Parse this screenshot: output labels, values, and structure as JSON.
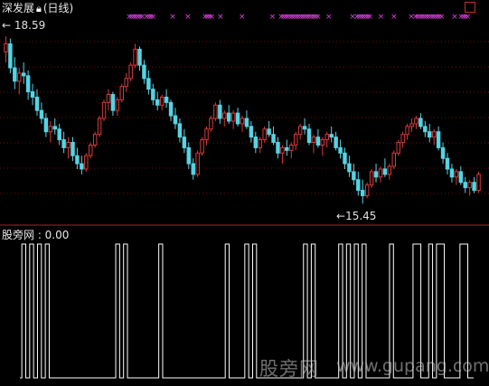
{
  "header": {
    "title": "深发展",
    "lock_icon": "lock-icon",
    "period": "(日线)"
  },
  "price_panel": {
    "high_label": "18.59",
    "low_label": "15.45",
    "arrow": "←",
    "up_color": "#d83a3a",
    "down_color": "#54d4e4",
    "signal_color": "#e040e0"
  },
  "indicator_panel": {
    "label": "股旁网 : 0.00",
    "line_color": "#ffffff"
  },
  "watermark": {
    "text": "股旁网",
    "url": "www.gupang.com"
  },
  "chart_data": {
    "type": "candlestick",
    "high": 18.59,
    "low": 15.45,
    "ylim": [
      15.2,
      18.9
    ],
    "signals_top": [
      20,
      21,
      22,
      23,
      24,
      25,
      26,
      28,
      29,
      30,
      31,
      40,
      47,
      55,
      56,
      57,
      58,
      62,
      72,
      86,
      90,
      91,
      92,
      93,
      94,
      95,
      96,
      97,
      98,
      99,
      100,
      101,
      102,
      103,
      104,
      105,
      106,
      107,
      112,
      123,
      125,
      126,
      127,
      128,
      129,
      130,
      131,
      136,
      142,
      150,
      152,
      153,
      154,
      155,
      156,
      157,
      158,
      159,
      160,
      161,
      162,
      163,
      164,
      170,
      173,
      174,
      175,
      176
    ],
    "candles": [
      [
        18.3,
        18.59,
        18.1,
        18.45
      ],
      [
        18.45,
        18.55,
        17.9,
        18.0
      ],
      [
        18.0,
        18.2,
        17.6,
        17.75
      ],
      [
        17.75,
        18.0,
        17.5,
        17.9
      ],
      [
        17.9,
        18.1,
        17.7,
        17.85
      ],
      [
        17.85,
        17.95,
        17.4,
        17.55
      ],
      [
        17.55,
        17.7,
        17.3,
        17.45
      ],
      [
        17.45,
        17.6,
        17.1,
        17.2
      ],
      [
        17.2,
        17.35,
        16.95,
        17.05
      ],
      [
        17.05,
        17.15,
        16.7,
        16.8
      ],
      [
        16.8,
        17.0,
        16.6,
        16.9
      ],
      [
        16.9,
        17.05,
        16.75,
        16.85
      ],
      [
        16.85,
        16.95,
        16.55,
        16.65
      ],
      [
        16.65,
        16.8,
        16.4,
        16.5
      ],
      [
        16.5,
        16.7,
        16.3,
        16.6
      ],
      [
        16.6,
        16.7,
        16.25,
        16.35
      ],
      [
        16.35,
        16.5,
        16.1,
        16.2
      ],
      [
        16.2,
        16.35,
        16.0,
        16.1
      ],
      [
        16.1,
        16.4,
        16.05,
        16.35
      ],
      [
        16.35,
        16.6,
        16.3,
        16.55
      ],
      [
        16.55,
        16.8,
        16.5,
        16.75
      ],
      [
        16.75,
        17.1,
        16.7,
        17.05
      ],
      [
        17.05,
        17.4,
        17.0,
        17.35
      ],
      [
        17.35,
        17.6,
        17.2,
        17.5
      ],
      [
        17.5,
        17.55,
        17.1,
        17.2
      ],
      [
        17.2,
        17.45,
        17.1,
        17.4
      ],
      [
        17.4,
        17.7,
        17.35,
        17.65
      ],
      [
        17.65,
        17.9,
        17.55,
        17.8
      ],
      [
        17.8,
        18.1,
        17.75,
        18.05
      ],
      [
        18.05,
        18.45,
        18.0,
        18.35
      ],
      [
        18.35,
        18.4,
        17.95,
        18.05
      ],
      [
        18.05,
        18.15,
        17.7,
        17.8
      ],
      [
        17.8,
        17.95,
        17.5,
        17.6
      ],
      [
        17.6,
        17.7,
        17.3,
        17.4
      ],
      [
        17.4,
        17.55,
        17.2,
        17.3
      ],
      [
        17.3,
        17.5,
        17.2,
        17.45
      ],
      [
        17.45,
        17.6,
        17.25,
        17.35
      ],
      [
        17.35,
        17.4,
        17.0,
        17.1
      ],
      [
        17.1,
        17.25,
        16.85,
        16.95
      ],
      [
        16.95,
        17.05,
        16.6,
        16.7
      ],
      [
        16.7,
        16.85,
        16.4,
        16.5
      ],
      [
        16.5,
        16.6,
        16.1,
        16.2
      ],
      [
        16.2,
        16.3,
        15.9,
        16.0
      ],
      [
        16.0,
        16.45,
        15.95,
        16.4
      ],
      [
        16.4,
        16.7,
        16.35,
        16.65
      ],
      [
        16.65,
        16.9,
        16.55,
        16.85
      ],
      [
        16.85,
        17.1,
        16.8,
        17.05
      ],
      [
        17.05,
        17.35,
        17.0,
        17.3
      ],
      [
        17.3,
        17.4,
        16.95,
        17.05
      ],
      [
        17.05,
        17.2,
        16.9,
        17.15
      ],
      [
        17.15,
        17.3,
        16.95,
        17.0
      ],
      [
        17.0,
        17.2,
        16.85,
        17.15
      ],
      [
        17.15,
        17.25,
        16.9,
        16.95
      ],
      [
        16.95,
        17.1,
        16.8,
        17.05
      ],
      [
        17.05,
        17.2,
        16.85,
        16.9
      ],
      [
        16.9,
        17.0,
        16.6,
        16.7
      ],
      [
        16.7,
        16.8,
        16.4,
        16.5
      ],
      [
        16.5,
        16.7,
        16.4,
        16.65
      ],
      [
        16.65,
        16.9,
        16.6,
        16.85
      ],
      [
        16.85,
        17.0,
        16.7,
        16.75
      ],
      [
        16.75,
        16.9,
        16.55,
        16.6
      ],
      [
        16.6,
        16.7,
        16.3,
        16.4
      ],
      [
        16.4,
        16.55,
        16.2,
        16.5
      ],
      [
        16.5,
        16.65,
        16.35,
        16.45
      ],
      [
        16.45,
        16.6,
        16.3,
        16.55
      ],
      [
        16.55,
        16.8,
        16.45,
        16.75
      ],
      [
        16.75,
        16.95,
        16.65,
        16.9
      ],
      [
        16.9,
        17.05,
        16.75,
        16.85
      ],
      [
        16.85,
        16.95,
        16.55,
        16.6
      ],
      [
        16.6,
        16.75,
        16.4,
        16.7
      ],
      [
        16.7,
        16.85,
        16.5,
        16.55
      ],
      [
        16.55,
        16.7,
        16.35,
        16.65
      ],
      [
        16.65,
        16.8,
        16.5,
        16.75
      ],
      [
        16.75,
        16.9,
        16.6,
        16.7
      ],
      [
        16.7,
        16.8,
        16.45,
        16.5
      ],
      [
        16.5,
        16.65,
        16.3,
        16.4
      ],
      [
        16.4,
        16.5,
        16.1,
        16.2
      ],
      [
        16.2,
        16.35,
        15.95,
        16.05
      ],
      [
        16.05,
        16.2,
        15.8,
        15.9
      ],
      [
        15.9,
        16.05,
        15.6,
        15.7
      ],
      [
        15.7,
        15.9,
        15.45,
        15.6
      ],
      [
        15.6,
        15.85,
        15.55,
        15.8
      ],
      [
        15.8,
        16.1,
        15.75,
        16.05
      ],
      [
        16.05,
        16.2,
        15.85,
        15.95
      ],
      [
        15.95,
        16.15,
        15.85,
        16.1
      ],
      [
        16.1,
        16.3,
        15.95,
        16.0
      ],
      [
        16.0,
        16.2,
        15.9,
        16.15
      ],
      [
        16.15,
        16.45,
        16.1,
        16.4
      ],
      [
        16.4,
        16.65,
        16.35,
        16.6
      ],
      [
        16.6,
        16.8,
        16.5,
        16.75
      ],
      [
        16.75,
        16.95,
        16.65,
        16.9
      ],
      [
        16.9,
        17.05,
        16.8,
        16.95
      ],
      [
        16.95,
        17.1,
        16.85,
        17.05
      ],
      [
        17.05,
        17.15,
        16.85,
        16.9
      ],
      [
        16.9,
        17.0,
        16.7,
        16.8
      ],
      [
        16.8,
        16.95,
        16.6,
        16.7
      ],
      [
        16.7,
        16.85,
        16.55,
        16.8
      ],
      [
        16.8,
        16.9,
        16.45,
        16.5
      ],
      [
        16.5,
        16.6,
        16.2,
        16.3
      ],
      [
        16.3,
        16.4,
        16.0,
        16.1
      ],
      [
        16.1,
        16.2,
        15.85,
        15.95
      ],
      [
        15.95,
        16.1,
        15.8,
        16.05
      ],
      [
        16.05,
        16.15,
        15.8,
        15.85
      ],
      [
        15.85,
        15.95,
        15.65,
        15.75
      ],
      [
        15.75,
        15.9,
        15.6,
        15.85
      ],
      [
        15.85,
        15.95,
        15.65,
        15.7
      ],
      [
        15.7,
        16.05,
        15.65,
        16.0
      ]
    ],
    "indicator": [
      0,
      1,
      0,
      1,
      0,
      1,
      0,
      1,
      0,
      0,
      0,
      0,
      0,
      0,
      0,
      0,
      0,
      0,
      0,
      0,
      0,
      0,
      0,
      0,
      0,
      1,
      0,
      1,
      0,
      0,
      0,
      0,
      0,
      0,
      0,
      0,
      1,
      0,
      0,
      0,
      0,
      0,
      0,
      0,
      0,
      0,
      0,
      0,
      0,
      0,
      0,
      0,
      0,
      1,
      0,
      0,
      0,
      0,
      1,
      0,
      1,
      0,
      0,
      0,
      0,
      0,
      0,
      0,
      0,
      0,
      0,
      0,
      0,
      1,
      0,
      1,
      0,
      0,
      0,
      0,
      0,
      0,
      1,
      0,
      1,
      0,
      1,
      0,
      1,
      0,
      0,
      0,
      0,
      0,
      0,
      1,
      0,
      0,
      0,
      0,
      0,
      1,
      1,
      0,
      0,
      1,
      0,
      1,
      1,
      0,
      0,
      0,
      0,
      1,
      1,
      0,
      0
    ]
  }
}
